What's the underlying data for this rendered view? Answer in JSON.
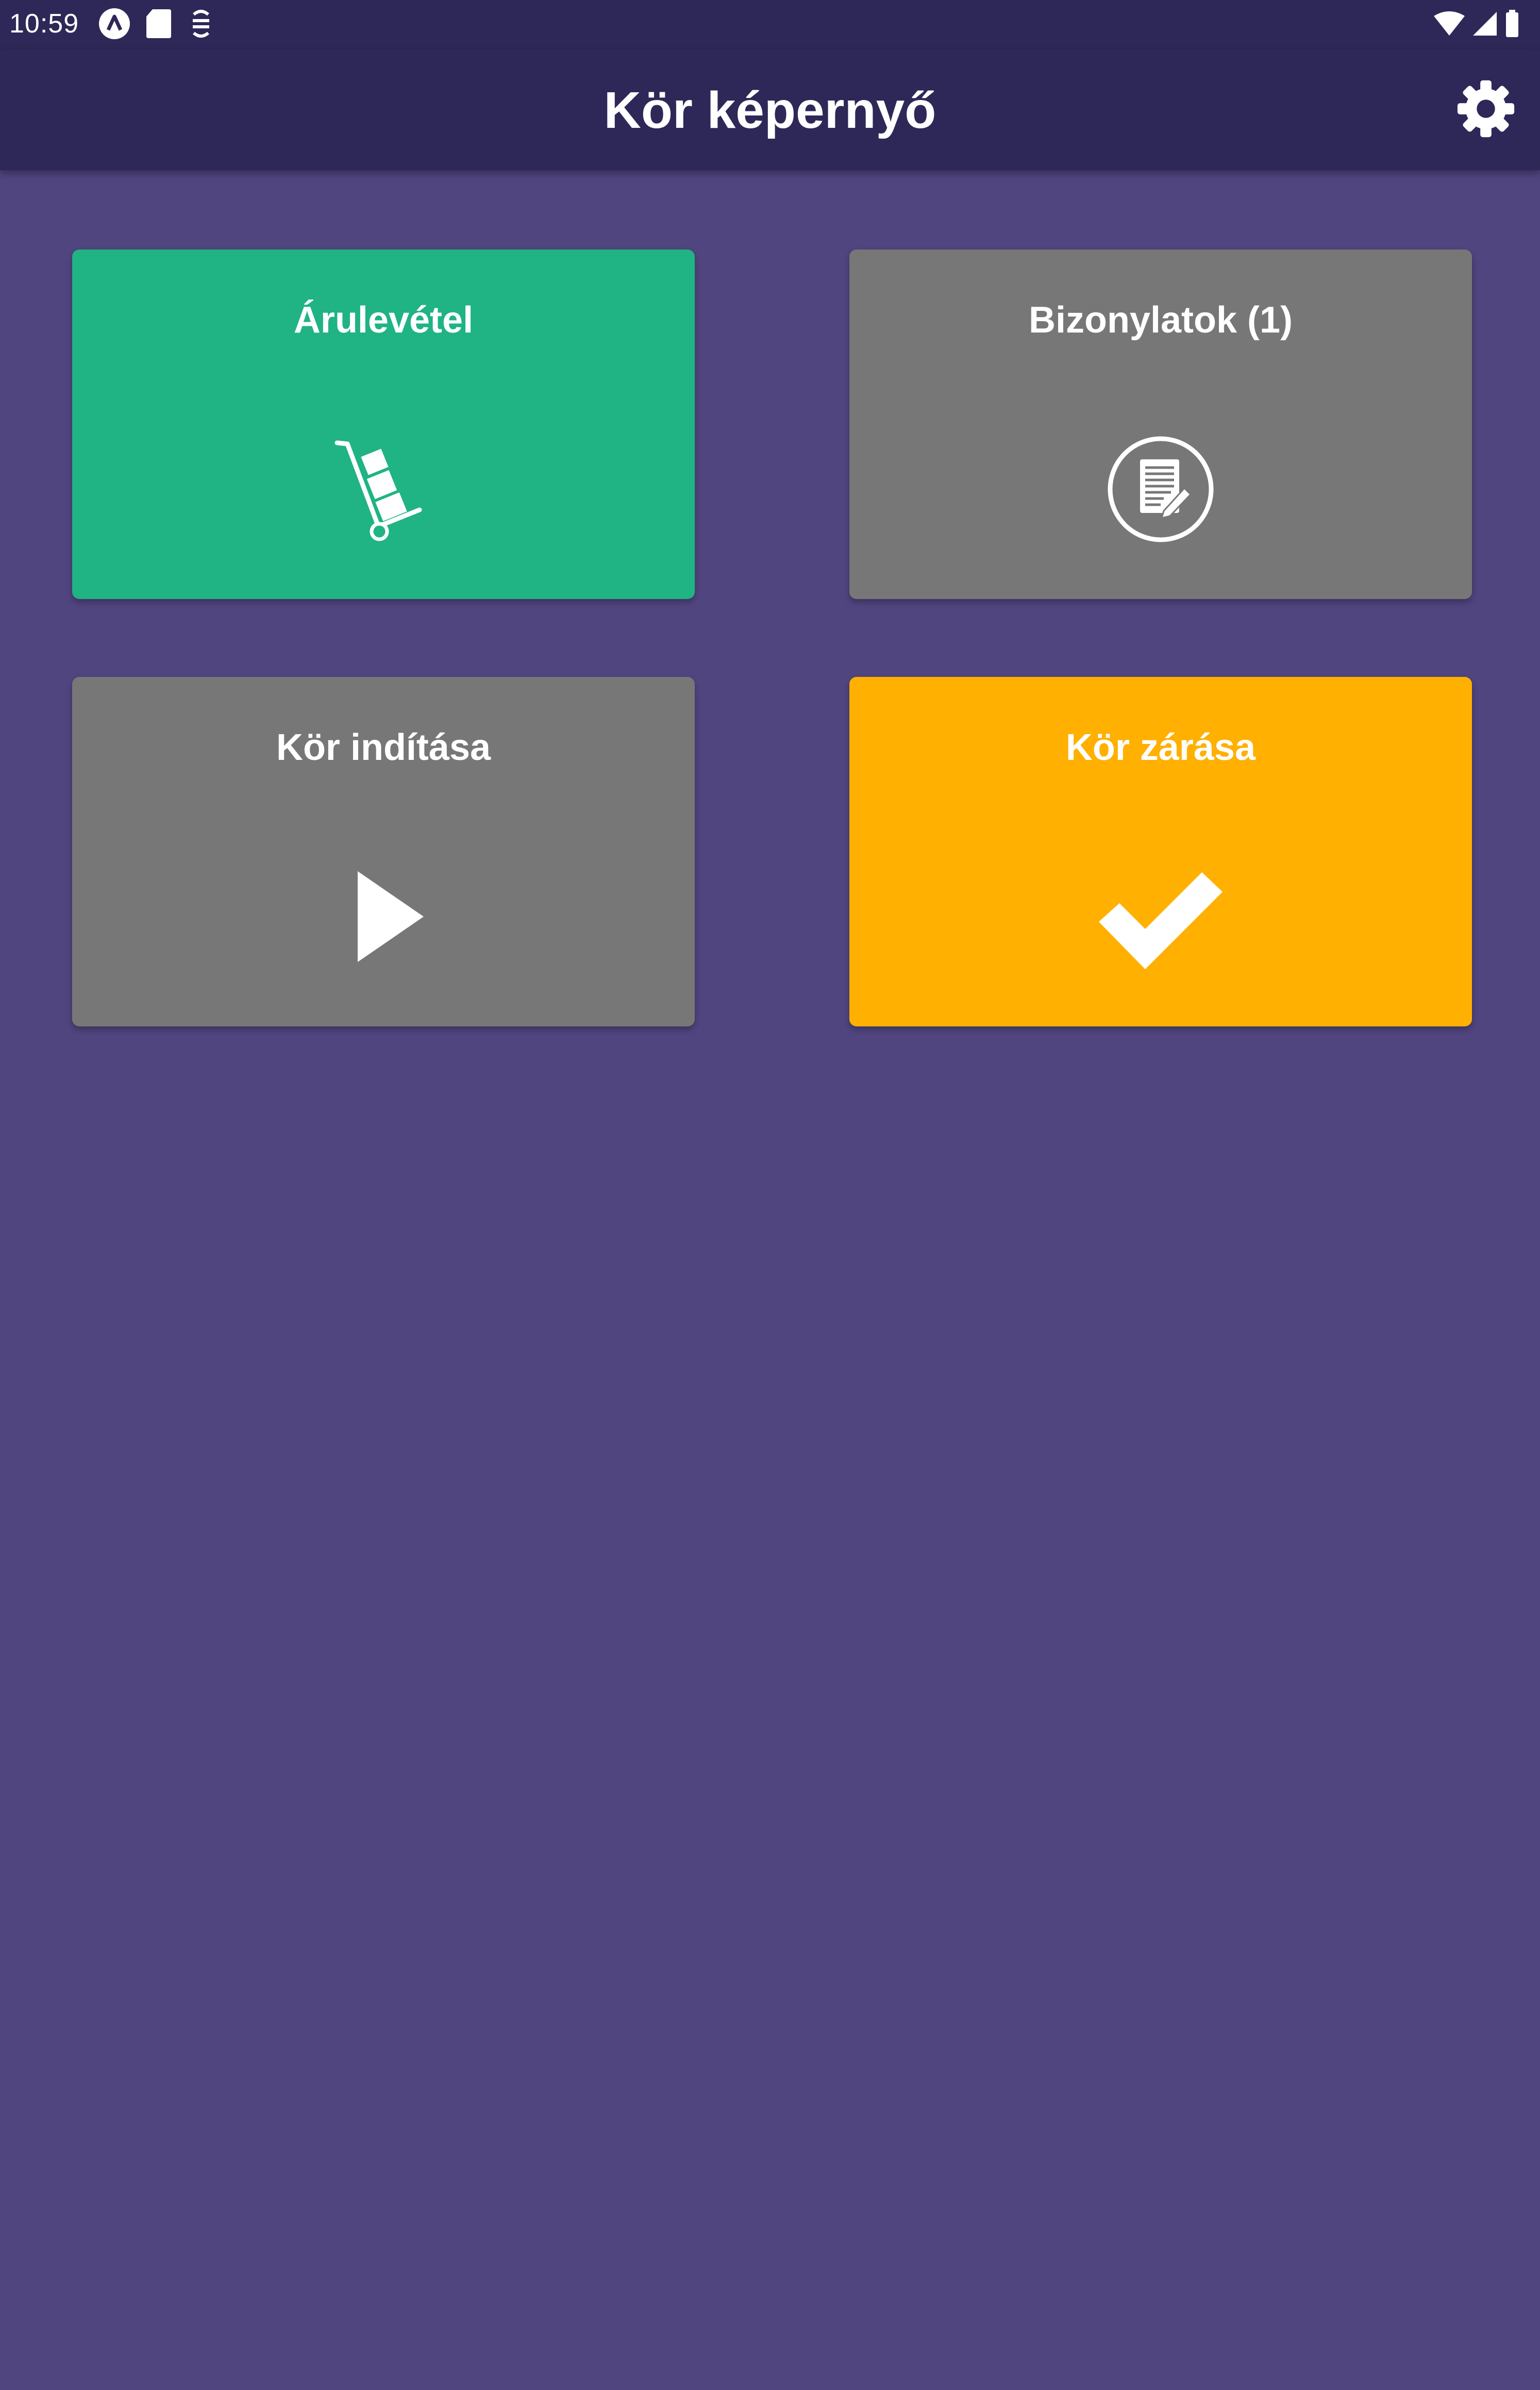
{
  "status_bar": {
    "time": "10:59"
  },
  "app_bar": {
    "title": "Kör képernyő",
    "settings_icon": "gear-icon"
  },
  "tiles": [
    {
      "label": "Árulevétel",
      "color": "#20b383",
      "icon": "hand-truck-icon"
    },
    {
      "label": "Bizonylatok (1)",
      "color": "#777777",
      "icon": "document-edit-icon"
    },
    {
      "label": "Kör indítása",
      "color": "#777777",
      "icon": "play-icon"
    },
    {
      "label": "Kör zárása",
      "color": "#ffb000",
      "icon": "checkmark-icon"
    }
  ],
  "colors": {
    "background": "#50457f",
    "app_bar": "#2e2858"
  }
}
